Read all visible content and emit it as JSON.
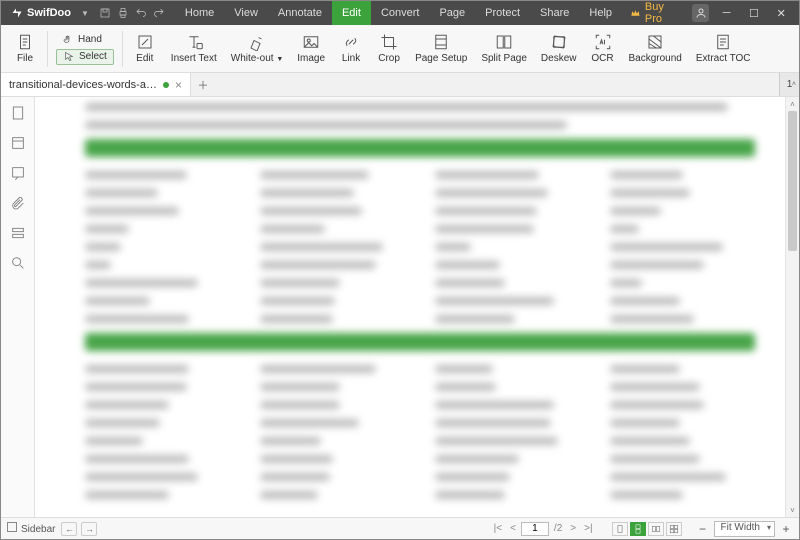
{
  "app": {
    "name": "SwifDoo",
    "buy_label": "Buy Pro"
  },
  "menus": [
    "Home",
    "View",
    "Annotate",
    "Edit",
    "Convert",
    "Page",
    "Protect",
    "Share",
    "Help"
  ],
  "active_menu": "Edit",
  "ribbon": {
    "file": "File",
    "hand": "Hand",
    "select": "Select",
    "edit": "Edit",
    "insert_text": "Insert Text",
    "whiteout": "White-out",
    "image": "Image",
    "link": "Link",
    "crop": "Crop",
    "page_setup": "Page Setup",
    "split_page": "Split Page",
    "deskew": "Deskew",
    "ocr": "OCR",
    "background": "Background",
    "extract_toc": "Extract TOC"
  },
  "tab": {
    "label": "transitional-devices-words-an…"
  },
  "page_indicator": "1",
  "status": {
    "sidebar_label": "Sidebar",
    "current_page": "1",
    "total_pages": "/2",
    "zoom_label": "Fit Width"
  }
}
